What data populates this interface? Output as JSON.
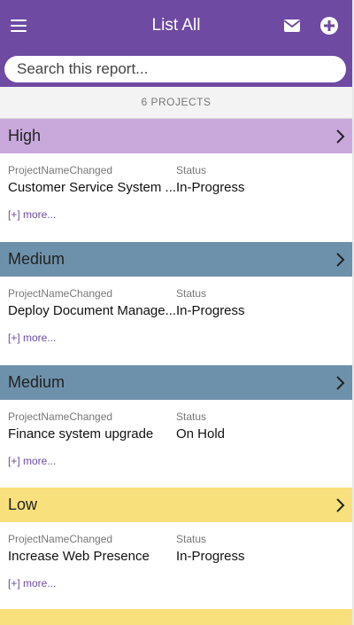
{
  "header": {
    "title": "List All",
    "menu_icon": "hamburger-menu-icon",
    "mail_icon": "envelope-icon",
    "add_icon": "plus-circle-icon",
    "color": "#6e4aa3"
  },
  "search": {
    "placeholder": "Search this report..."
  },
  "summary": {
    "count_label": "6 PROJECTS"
  },
  "columns": {
    "name_label": "ProjectNameChanged",
    "status_label": "Status"
  },
  "groups": [
    {
      "priority": "High",
      "color": "#c9a9dc",
      "project": "Customer Service System ...",
      "status": "In-Progress",
      "more": "[+] more..."
    },
    {
      "priority": "Medium",
      "color": "#6e91ab",
      "project": "Deploy Document Manage...",
      "status": "In-Progress",
      "more": "[+] more..."
    },
    {
      "priority": "Medium",
      "color": "#6e91ab",
      "project": "Finance system upgrade",
      "status": "On Hold",
      "more": "[+] more..."
    },
    {
      "priority": "Low",
      "color": "#f8e07c",
      "project": "Increase Web Presence",
      "status": "In-Progress",
      "more": "[+] more..."
    }
  ]
}
